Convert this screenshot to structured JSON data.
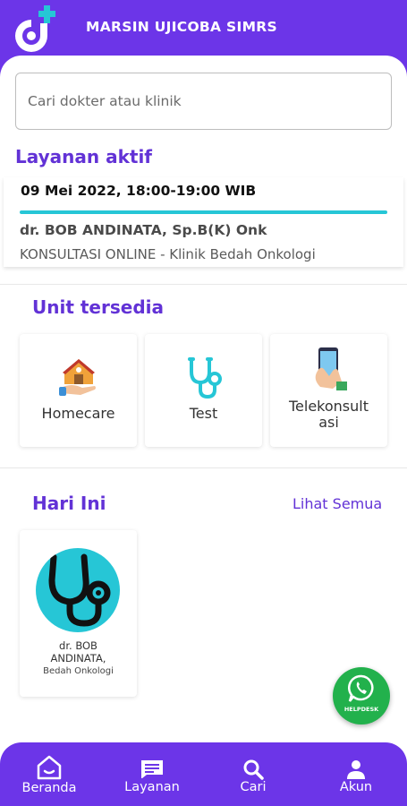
{
  "app": {
    "title": "MARSIN UJICOBA SIMRS"
  },
  "search": {
    "placeholder": "Cari dokter atau klinik"
  },
  "active_services": {
    "title": "Layanan aktif",
    "items": [
      {
        "datetime": "09 Mei 2022, 18:00-19:00 WIB",
        "doctor": "dr. BOB ANDINATA, Sp.B(K) Onk",
        "service": "KONSULTASI ONLINE - Klinik Bedah Onkologi"
      }
    ]
  },
  "units": {
    "title": "Unit tersedia",
    "items": [
      {
        "label": "Homecare",
        "icon": "house-hand-icon"
      },
      {
        "label": "Test",
        "icon": "stethoscope-icon"
      },
      {
        "label": "Telekonsult\nasi",
        "icon": "phone-hand-icon"
      }
    ]
  },
  "today": {
    "title": "Hari Ini",
    "see_all": "Lihat Semua",
    "doctors": [
      {
        "name": "dr. BOB\nANDINATA,",
        "specialty": "Bedah Onkologi",
        "icon": "stethoscope-icon"
      }
    ]
  },
  "helpdesk": {
    "label": "HELPDESK",
    "icon": "whatsapp-icon"
  },
  "bottom_nav": {
    "items": [
      {
        "label": "Beranda",
        "icon": "home-icon"
      },
      {
        "label": "Layanan",
        "icon": "message-list-icon"
      },
      {
        "label": "Cari",
        "icon": "search-icon"
      },
      {
        "label": "Akun",
        "icon": "user-icon"
      }
    ]
  },
  "colors": {
    "brand": "#6c35e8",
    "accent_text": "#6232d6",
    "teal": "#26c6d6",
    "whatsapp": "#22b14c"
  }
}
